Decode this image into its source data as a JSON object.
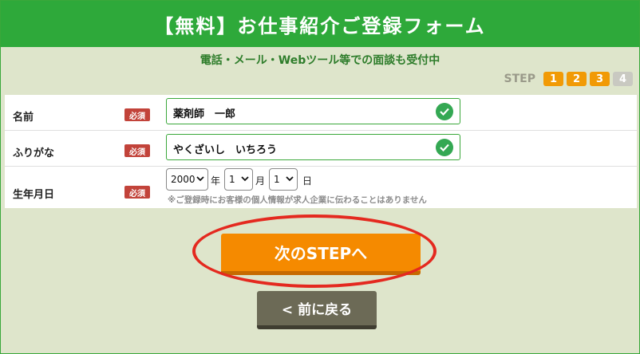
{
  "header": {
    "title": "【無料】お仕事紹介ご登録フォーム"
  },
  "subtitle": "電話・メール・Webツール等での面談も受付中",
  "steps": {
    "label": "STEP",
    "items": [
      "1",
      "2",
      "3",
      "4"
    ],
    "current": 3
  },
  "form": {
    "required_badge": "必須",
    "name": {
      "label": "名前",
      "value": "薬剤師　一郎"
    },
    "kana": {
      "label": "ふりがな",
      "value": "やくざいし　いちろう"
    },
    "birth": {
      "label": "生年月日",
      "year": "2000",
      "year_unit": "年",
      "month": "1",
      "month_unit": "月",
      "day": "1",
      "day_unit": "日",
      "note": "※ご登録時にお客様の個人情報が求人企業に伝わることはありません"
    }
  },
  "buttons": {
    "next": "次のSTEPへ",
    "back": "< 前に戻る"
  },
  "colors": {
    "header_green": "#2ea93a",
    "next_orange": "#f58a00",
    "highlight_red": "#e4291f"
  }
}
